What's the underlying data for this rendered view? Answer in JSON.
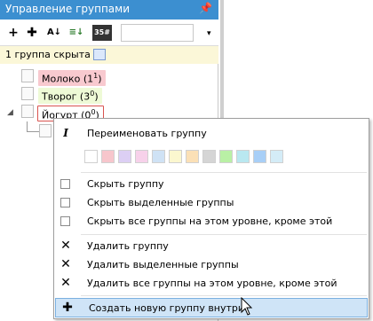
{
  "panel": {
    "title": "Управление группами",
    "pin_glyph": "ꟷ",
    "hidden_text": "1 группа скрыта"
  },
  "toolbar": {
    "b1": "+",
    "b2": "✚",
    "b3": "A↓",
    "b4": "≡↓",
    "b5": "35#",
    "overflow": "▾"
  },
  "tree": [
    {
      "label": "Молоко (1",
      "sup": "1",
      "close": ")",
      "color": "#f8c9cf"
    },
    {
      "label": "Творог (3",
      "sup": "0",
      "close": ")",
      "color": "#eefad6"
    },
    {
      "label": "Йогурт (0",
      "sup": "0",
      "close": ")",
      "color": "#ffffff"
    }
  ],
  "menu": {
    "rename": "Переименовать группу",
    "hide_group": "Скрыть группу",
    "hide_selected": "Скрыть выделенные группы",
    "hide_all_other": "Скрыть все группы на этом уровне, кроме этой",
    "delete_group": "Удалить группу",
    "delete_selected": "Удалить выделенные группы",
    "delete_all_other": "Удалить все группы на этом уровне, кроме этой",
    "create_inside": "Создать новую группу внутри",
    "swatch_colors": [
      "#ffffff",
      "#f7c6cc",
      "#dccff4",
      "#f7d1ea",
      "#cfe2f5",
      "#fbf7cf",
      "#fbe0b6",
      "#d5d5d5",
      "#b9f0a5",
      "#b9e8f0",
      "#a8cff7",
      "#d4ecf7"
    ]
  }
}
